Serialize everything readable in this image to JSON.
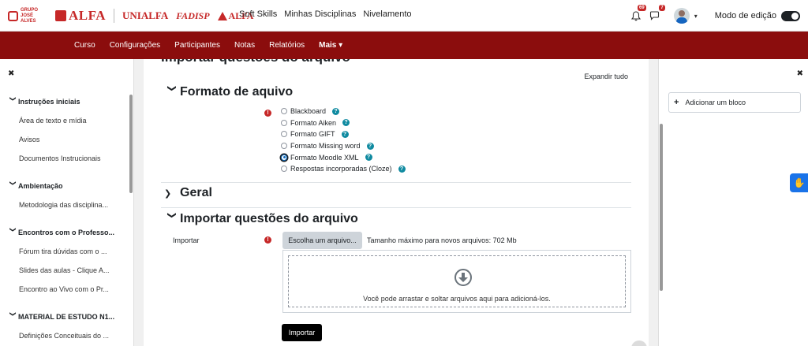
{
  "logos": {
    "grupo": "GRUPO JOSÉ ALVES",
    "alfa": "ALFA",
    "unialfa": "UNIALFA",
    "fadisp": "FADISP",
    "colegio": "ALFA"
  },
  "topnav": [
    "Soft Skills",
    "Minhas Disciplinas",
    "Nivelamento"
  ],
  "notifications": {
    "notif_count": "69",
    "msg_count": "7"
  },
  "edit_mode_label": "Modo de edição",
  "rednav": [
    "Curso",
    "Configurações",
    "Participantes",
    "Notas",
    "Relatórios",
    "Mais ▾"
  ],
  "left_drawer": {
    "sections": [
      {
        "title": "Instruções iniciais",
        "items": [
          "Área de texto e mídia",
          "Avisos",
          "Documentos Instrucionais"
        ]
      },
      {
        "title": "Ambientação",
        "items": [
          "Metodologia das disciplina..."
        ]
      },
      {
        "title": "Encontros com o Professo...",
        "items": [
          "Fórum tira dúvidas com o ...",
          "Slides das aulas - Clique A...",
          "Encontro ao Vivo com o Pr..."
        ]
      },
      {
        "title": "MATERIAL DE ESTUDO N1...",
        "items": [
          "Definições Conceituais do ..."
        ]
      }
    ]
  },
  "main": {
    "clipped_title": "Importar questões do arquivo",
    "expand_all": "Expandir tudo",
    "section_format": "Formato de aquivo",
    "formats": [
      {
        "label": "Blackboard",
        "checked": false
      },
      {
        "label": "Formato Aiken",
        "checked": false
      },
      {
        "label": "Formato GIFT",
        "checked": false
      },
      {
        "label": "Formato Missing word",
        "checked": false
      },
      {
        "label": "Formato Moodle XML",
        "checked": true
      },
      {
        "label": "Respostas incorporadas (Cloze)",
        "checked": false
      }
    ],
    "section_general": "Geral",
    "section_import": "Importar questões do arquivo",
    "import_label": "Importar",
    "choose_file": "Escolha um arquivo...",
    "max_size": "Tamanho máximo para novos arquivos: 702 Mb",
    "drop_text": "Você pode arrastar e soltar arquivos aqui para adicioná-los.",
    "submit": "Importar"
  },
  "right_drawer": {
    "add_block": "Adicionar um bloco"
  },
  "colors": {
    "brand_red": "#8b0d0d",
    "help_teal": "#0f8aa0",
    "required_red": "#c62828"
  }
}
